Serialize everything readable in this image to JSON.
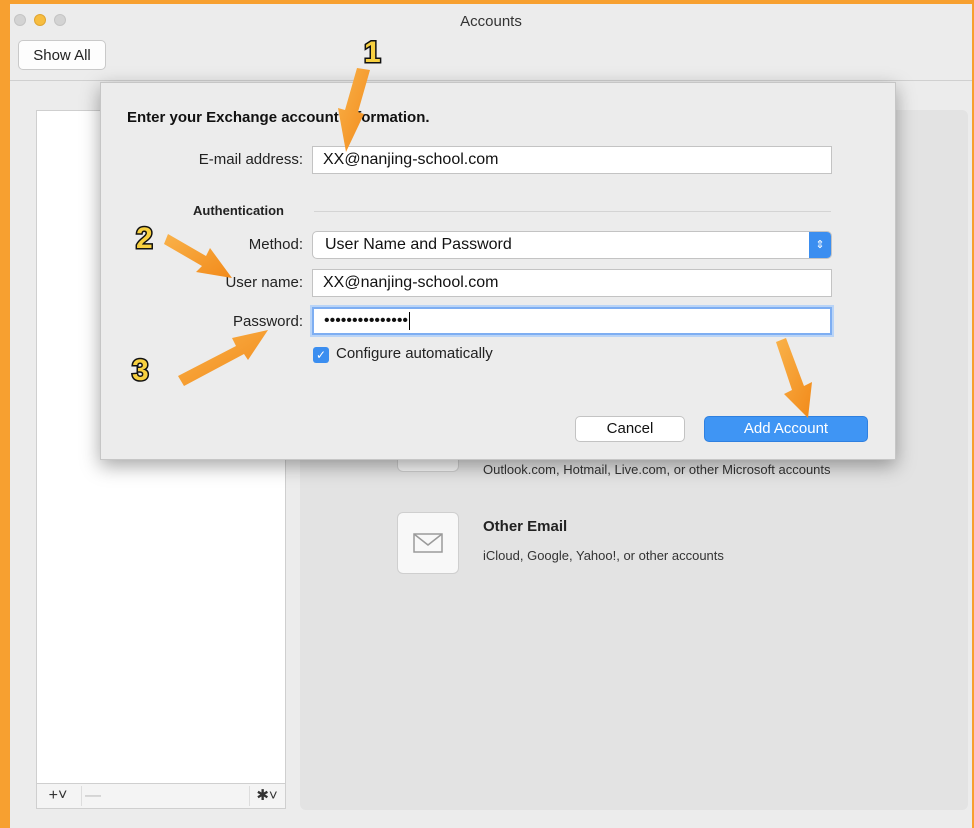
{
  "window": {
    "title": "Accounts",
    "show_all": "Show All"
  },
  "toolbar": {
    "add": "+˅",
    "remove": "—",
    "gear": "✱˅"
  },
  "services": [
    {
      "desc": "Outlook.com, Hotmail, Live.com, or other Microsoft accounts",
      "icon": "outlook-icon"
    },
    {
      "title": "Other Email",
      "desc": "iCloud, Google, Yahoo!, or other accounts",
      "icon": "envelope-icon"
    }
  ],
  "dialog": {
    "heading": "Enter your Exchange account information.",
    "email_label": "E-mail address:",
    "email_value": "XX@nanjing-school.com",
    "auth_heading": "Authentication",
    "method_label": "Method:",
    "method_value": "User Name and Password",
    "username_label": "User name:",
    "username_value": "XX@nanjing-school.com",
    "password_label": "Password:",
    "password_value": "•••••••••••••••",
    "configure_label": "Configure automatically",
    "configure_checked": true,
    "cancel": "Cancel",
    "add": "Add Account"
  },
  "annotations": {
    "n1": "1",
    "n2": "2",
    "n3": "3",
    "arrow_color": "#f7a030"
  }
}
